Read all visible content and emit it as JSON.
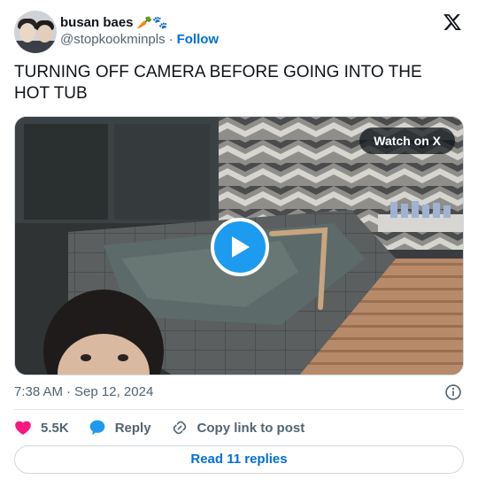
{
  "author": {
    "display_name": "busan baes",
    "name_emojis": "🥕🐾",
    "handle": "@stopkookminpls",
    "separator": "·",
    "follow_label": "Follow"
  },
  "tweet": {
    "text": "TURNING OFF CAMERA BEFORE GOING INTO THE HOT TUB",
    "time": "7:38 AM",
    "date_separator": "·",
    "date": "Sep 12, 2024"
  },
  "media": {
    "watch_label": "Watch on X",
    "kind": "video"
  },
  "actions": {
    "like_count": "5.5K",
    "reply_label": "Reply",
    "copy_label": "Copy link to post"
  },
  "read_replies_label": "Read 11 replies",
  "colors": {
    "link_blue": "#006fd6",
    "play_blue": "#1d9bf0",
    "heart_pink": "#f91880",
    "muted_text": "#536471"
  },
  "icons": {
    "logo": "x-logo-icon",
    "play": "play-icon",
    "info": "info-icon",
    "like": "heart-icon",
    "reply": "speech-bubble-icon",
    "copy": "link-icon"
  }
}
